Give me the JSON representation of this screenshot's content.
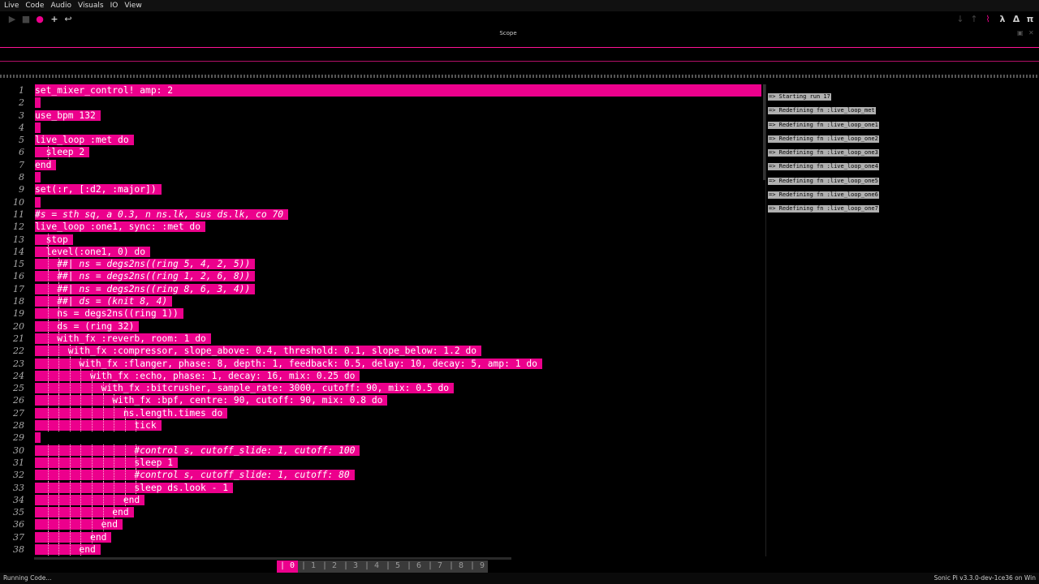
{
  "menu": [
    "Live",
    "Code",
    "Audio",
    "Visuals",
    "IO",
    "View"
  ],
  "toolbar_right_glyphs": {
    "scope": "⌇",
    "lambda": "λ",
    "delta": "Δ",
    "pi": "π"
  },
  "scope": {
    "title": "Scope"
  },
  "colors": {
    "accent": "#ec008c",
    "background": "#000000"
  },
  "editor": {
    "lines": [
      {
        "n": "1",
        "text": "set_mixer_control! amp: 2"
      },
      {
        "n": "2",
        "text": ""
      },
      {
        "n": "3",
        "text": "use_bpm 132"
      },
      {
        "n": "4",
        "text": ""
      },
      {
        "n": "5",
        "text": "live_loop :met do"
      },
      {
        "n": "6",
        "text": "  sleep 2"
      },
      {
        "n": "7",
        "text": "end"
      },
      {
        "n": "8",
        "text": ""
      },
      {
        "n": "9",
        "text": "set(:r, [:d2, :major])"
      },
      {
        "n": "10",
        "text": ""
      },
      {
        "n": "11",
        "text": "#s = sth sq, a 0.3, n ns.lk, sus ds.lk, co 70"
      },
      {
        "n": "12",
        "text": "live_loop :one1, sync: :met do"
      },
      {
        "n": "13",
        "text": "  stop"
      },
      {
        "n": "14",
        "text": "  level(:one1, 0) do"
      },
      {
        "n": "15",
        "text": "    ##| ns = degs2ns((ring 5, 4, 2, 5))"
      },
      {
        "n": "16",
        "text": "    ##| ns = degs2ns((ring 1, 2, 6, 8))"
      },
      {
        "n": "17",
        "text": "    ##| ns = degs2ns((ring 8, 6, 3, 4))"
      },
      {
        "n": "18",
        "text": "    ##| ds = (knit 8, 4)"
      },
      {
        "n": "19",
        "text": "    ns = degs2ns((ring 1))"
      },
      {
        "n": "20",
        "text": "    ds = (ring 32)"
      },
      {
        "n": "21",
        "text": "    with_fx :reverb, room: 1 do"
      },
      {
        "n": "22",
        "text": "      with_fx :compressor, slope_above: 0.4, threshold: 0.1, slope_below: 1.2 do"
      },
      {
        "n": "23",
        "text": "        with_fx :flanger, phase: 8, depth: 1, feedback: 0.5, delay: 10, decay: 5, amp: 1 do"
      },
      {
        "n": "24",
        "text": "          with_fx :echo, phase: 1, decay: 16, mix: 0.25 do"
      },
      {
        "n": "25",
        "text": "            with_fx :bitcrusher, sample_rate: 3000, cutoff: 90, mix: 0.5 do"
      },
      {
        "n": "26",
        "text": "              with_fx :bpf, centre: 90, cutoff: 90, mix: 0.8 do"
      },
      {
        "n": "27",
        "text": "                ns.length.times do"
      },
      {
        "n": "28",
        "text": "                  tick"
      },
      {
        "n": "29",
        "text": ""
      },
      {
        "n": "30",
        "text": "                  #control s, cutoff_slide: 1, cutoff: 100"
      },
      {
        "n": "31",
        "text": "                  sleep 1"
      },
      {
        "n": "32",
        "text": "                  #control s, cutoff_slide: 1, cutoff: 80"
      },
      {
        "n": "33",
        "text": "                  sleep ds.look - 1"
      },
      {
        "n": "34",
        "text": "                end"
      },
      {
        "n": "35",
        "text": "              end"
      },
      {
        "n": "36",
        "text": "            end"
      },
      {
        "n": "37",
        "text": "          end"
      },
      {
        "n": "38",
        "text": "        end"
      }
    ]
  },
  "log": [
    "=> Starting run 17",
    "=> Redefining fn :live_loop_met",
    "=> Redefining fn :live_loop_one1",
    "=> Redefining fn :live_loop_one2",
    "=> Redefining fn :live_loop_one3",
    "=> Redefining fn :live_loop_one4",
    "=> Redefining fn :live_loop_one5",
    "=> Redefining fn :live_loop_one6",
    "=> Redefining fn :live_loop_one7"
  ],
  "buffers": [
    "| 0 |",
    "| 1 |",
    "| 2 |",
    "| 3 |",
    "| 4 |",
    "| 5 |",
    "| 6 |",
    "| 7 |",
    "| 8 |",
    "| 9 |"
  ],
  "active_buffer": 0,
  "status": {
    "left": "Running Code...",
    "right": "Sonic Pi v3.3.0-dev-1ce36 on Win"
  }
}
